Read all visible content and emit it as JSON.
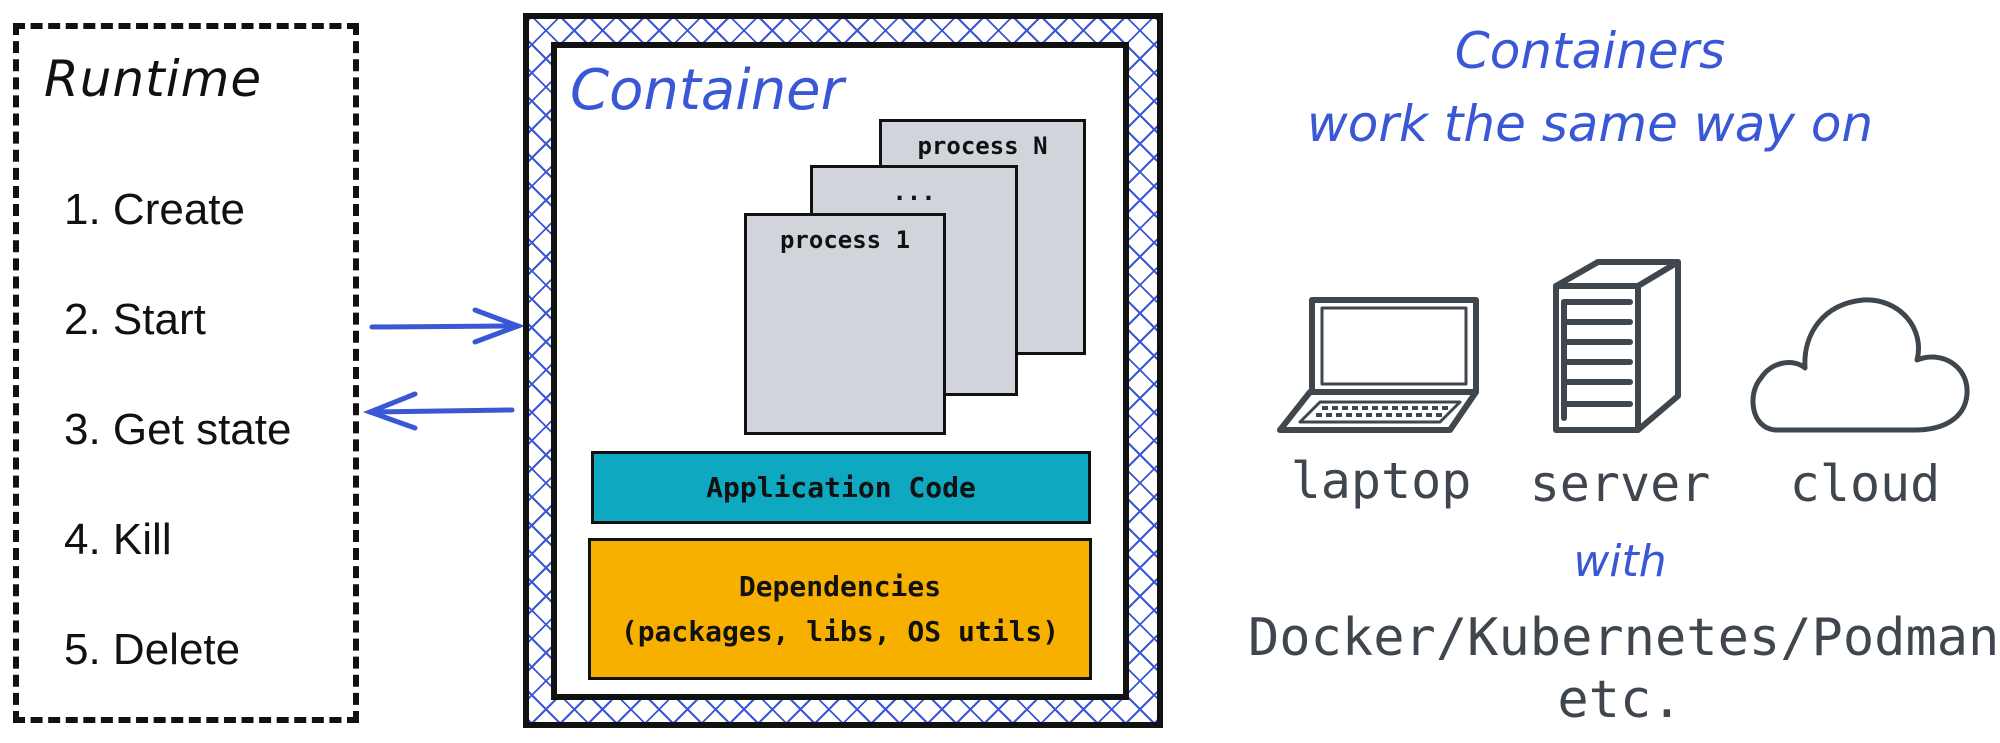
{
  "runtime": {
    "title": "Runtime",
    "steps": [
      "1. Create",
      "2. Start",
      "3. Get state",
      "4. Kill",
      "5. Delete"
    ]
  },
  "arrows": [
    {
      "direction": "runtime-to-container"
    },
    {
      "direction": "container-to-runtime"
    }
  ],
  "container": {
    "title": "Container",
    "processes": [
      "process N",
      "...",
      "process 1"
    ],
    "application_code": "Application Code",
    "dependencies": {
      "title": "Dependencies",
      "subtitle": "(packages, libs, OS utils)"
    }
  },
  "right": {
    "heading_line1": "Containers",
    "heading_line2": "work the same way on",
    "platforms": [
      {
        "icon": "laptop-icon",
        "label": "laptop"
      },
      {
        "icon": "server-icon",
        "label": "server"
      },
      {
        "icon": "cloud-icon",
        "label": "cloud"
      }
    ],
    "with": "with",
    "tools": "Docker/Kubernetes/Podman",
    "etc": "etc."
  },
  "colors": {
    "accent_blue": "#3a57d6",
    "process_gray": "#d1d5db",
    "application_teal": "#0ea8c0",
    "dependencies_orange": "#f7b000",
    "icon_gray": "#3f464d"
  }
}
